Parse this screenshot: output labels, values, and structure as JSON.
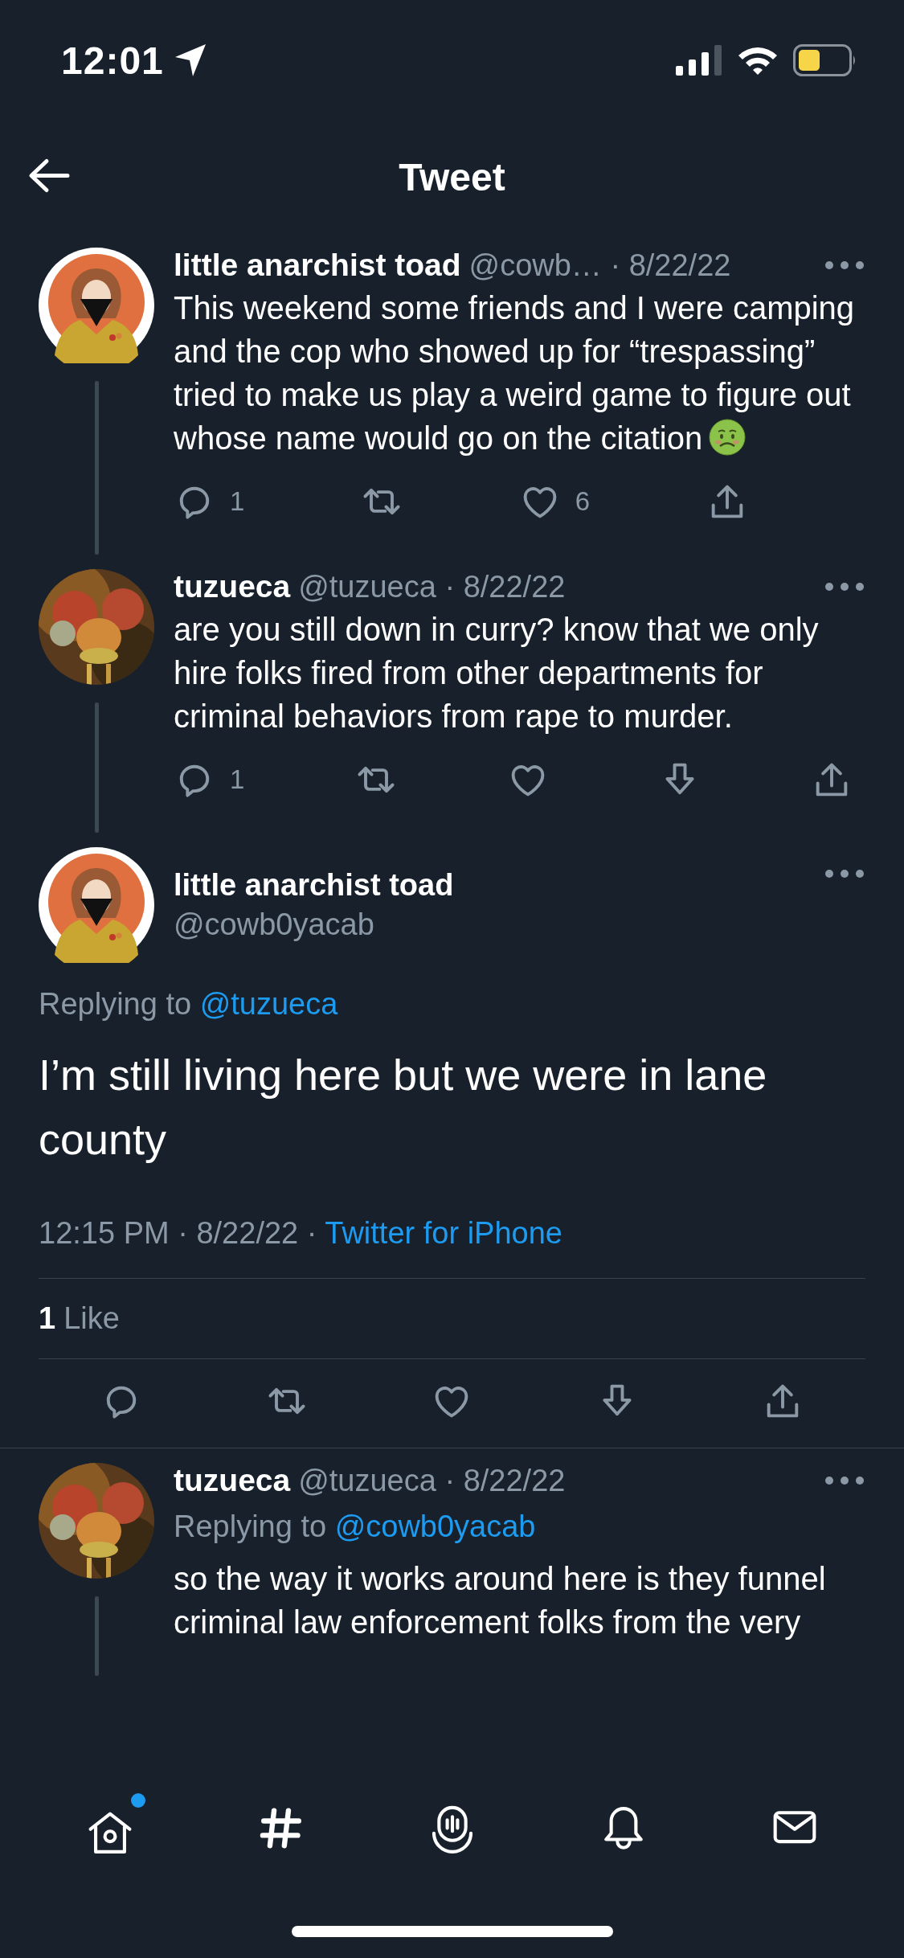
{
  "status_bar": {
    "time": "12:01"
  },
  "header": {
    "title": "Tweet"
  },
  "thread": [
    {
      "avatar": {
        "kind": "drawing"
      },
      "name": "little anarchist toad",
      "meta": "@cowb… · 8/22/22",
      "text": "This weekend some friends and I were camping and the cop who showed up for “trespassing” tried to make us play a weird game to figure out whose name would go on the citation",
      "emoji": {
        "kind": "nauseated"
      },
      "thread_line": true,
      "actions": [
        {
          "kind": "reply",
          "count": "1"
        },
        {
          "kind": "retweet"
        },
        {
          "kind": "like",
          "count": "6"
        },
        {
          "kind": "share"
        }
      ]
    },
    {
      "name": "tuzueca",
      "meta": "@tuzueca · 8/22/22",
      "text": "are you still down in curry? know that we only hire folks fired from other departments for criminal behaviors from rape to murder.",
      "thread_line": true,
      "actions": [
        {
          "kind": "reply",
          "count": "1"
        },
        {
          "kind": "retweet"
        },
        {
          "kind": "like"
        },
        {
          "kind": "downvote"
        },
        {
          "kind": "share"
        }
      ]
    }
  ],
  "main_tweet": {
    "avatar": {
      "kind": "drawing"
    },
    "name": "little anarchist toad",
    "handle": "@cowb0yacab",
    "replying_label": "Replying to",
    "replying_handle": "@tuzueca",
    "text": "I’m still living here but we were in lane county",
    "timestamp": "12:15 PM · 8/22/22 ·",
    "source": "Twitter for iPhone",
    "like_count": "1",
    "like_label": "Like",
    "actions": [
      {
        "kind": "reply"
      },
      {
        "kind": "retweet"
      },
      {
        "kind": "like"
      },
      {
        "kind": "downvote"
      },
      {
        "kind": "share"
      }
    ]
  },
  "replies": [
    {
      "name": "tuzueca",
      "meta": "@tuzueca · 8/22/22",
      "replying_label": "Replying to",
      "replying_handle": "@cowb0yacab",
      "text": "so the way it works around here is they funnel criminal law enforcement folks from the very",
      "thread_line": true
    }
  ],
  "tab_bar": [
    {
      "kind": "home",
      "badge": true
    },
    {
      "kind": "hashtag",
      "badge": false
    },
    {
      "kind": "spaces",
      "badge": false
    },
    {
      "kind": "bell",
      "badge": false
    },
    {
      "kind": "mail",
      "badge": false
    }
  ]
}
